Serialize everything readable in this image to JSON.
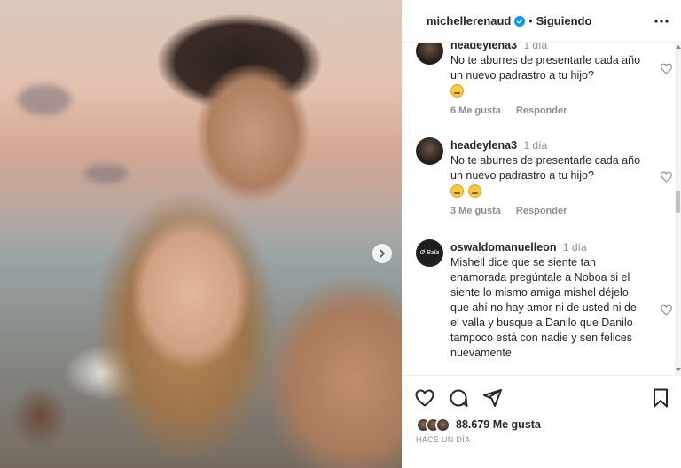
{
  "post": {
    "username": "michellerenaud",
    "separator": "•",
    "follow_status": "Siguiendo"
  },
  "comments": [
    {
      "username": "headeylena3",
      "time": "1 día",
      "text": "No te aburres de presentarle cada año un nuevo padrastro a tu hijo?",
      "likes": "6 Me gusta",
      "reply": "Responder"
    },
    {
      "username": "headeylena3",
      "time": "1 día",
      "text": "No te aburres de presentarle cada año un nuevo padrastro a tu hijo?",
      "likes": "3 Me gusta",
      "reply": "Responder"
    },
    {
      "username": "oswaldomanuelleon",
      "time": "1 día",
      "avatar_text": "Ø Bala",
      "text": "Mishell dice que se siente tan enamorada pregúntale a Noboa si el siente lo mismo amiga mishel déjelo que ahí no hay amor ni de usted ni de el valla y busque a Danilo que Danilo tampoco está con nadie y sen felices nuevamente"
    }
  ],
  "footer": {
    "likes_count": "88.679 Me gusta",
    "time_ago": "HACE UN DÍA"
  },
  "icons": {
    "like": "heart-icon",
    "comment": "comment-icon",
    "share": "send-icon",
    "save": "bookmark-icon",
    "more": "more-icon",
    "next": "chevron-right-icon",
    "verified": "verified-badge-icon"
  },
  "colors": {
    "verified": "#0095f6",
    "text": "#262626",
    "muted": "#8e8e8e"
  }
}
